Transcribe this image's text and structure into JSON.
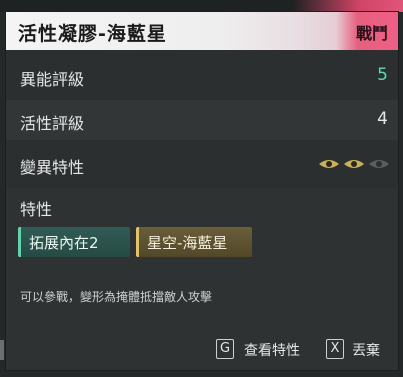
{
  "panel": {
    "title": "活性凝膠-海藍星",
    "tag": "戰鬥"
  },
  "stats": [
    {
      "label": "異能評級",
      "value": "5",
      "accent": "#5ed8b0"
    },
    {
      "label": "活性評級",
      "value": "4"
    },
    {
      "label": "變異特性",
      "eyes": {
        "filled": 2,
        "total": 3
      }
    }
  ],
  "traits": {
    "title": "特性",
    "chips": [
      {
        "label": "拓展內在2",
        "color": "#64d2b0"
      },
      {
        "label": "星空-海藍星",
        "color": "#e0c46a"
      }
    ]
  },
  "description": "可以參戰，變形為掩體抵擋敵人攻擊",
  "footer": {
    "view_key": "G",
    "view_label": "查看特性",
    "drop_key": "X",
    "drop_label": "丟棄"
  }
}
